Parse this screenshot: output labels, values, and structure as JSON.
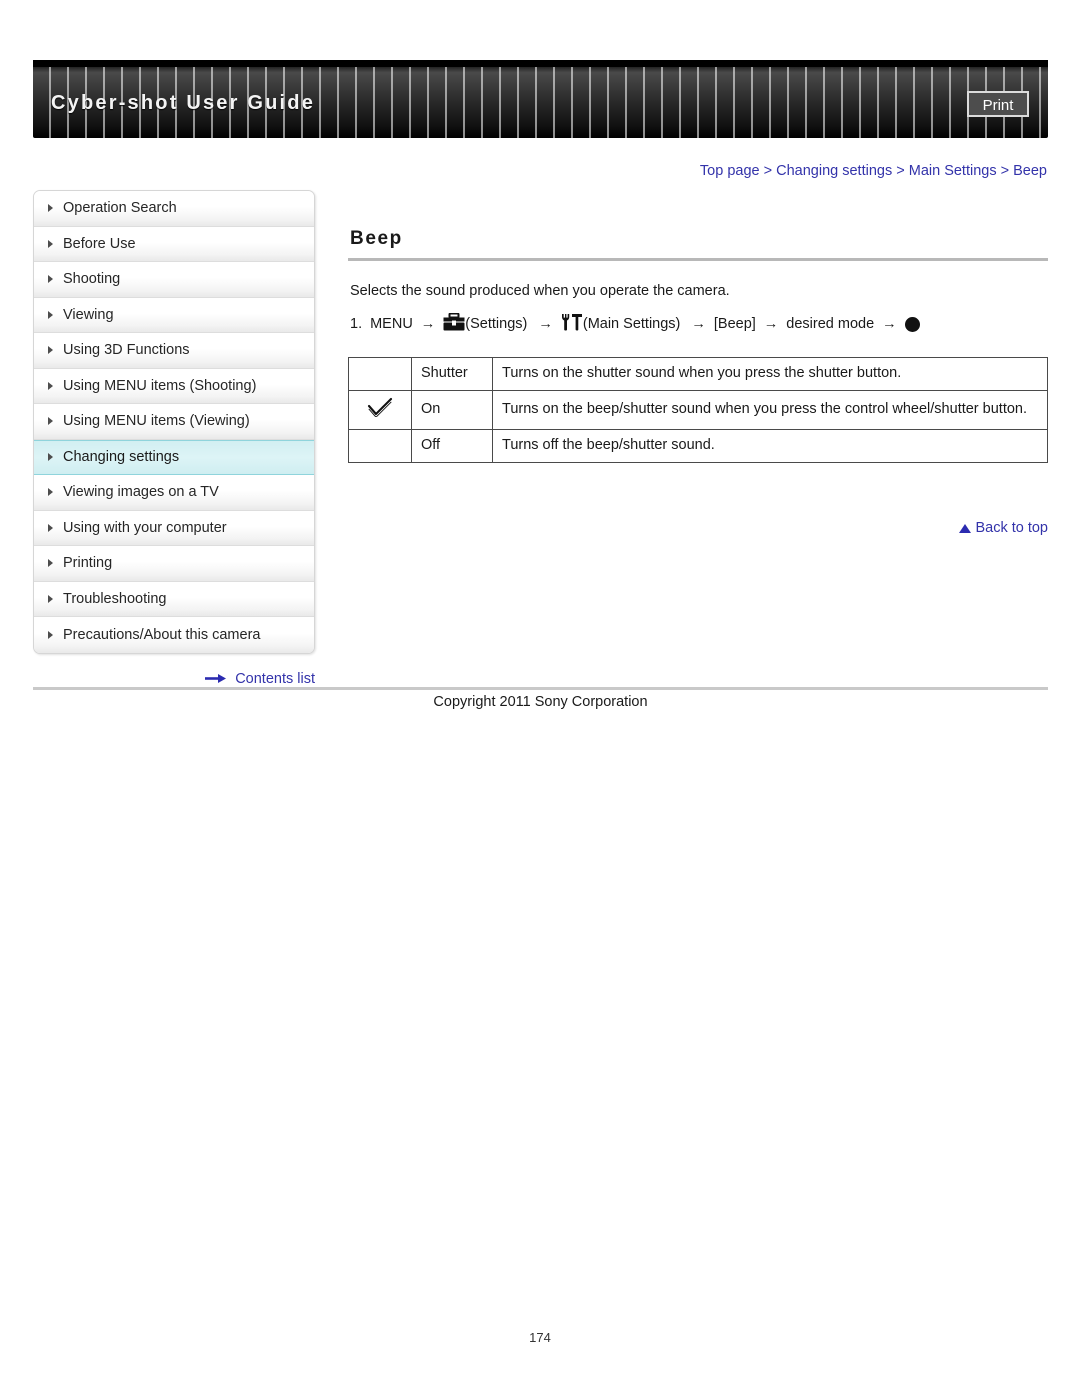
{
  "header": {
    "title": "Cyber-shot User Guide",
    "print_label": "Print"
  },
  "breadcrumb": {
    "items": [
      "Top page",
      "Changing settings",
      "Main Settings",
      "Beep"
    ],
    "separator": ">",
    "full_text": "Top page > Changing settings > Main Settings > Beep"
  },
  "sidebar": {
    "items": [
      {
        "label": "Operation Search",
        "selected": false
      },
      {
        "label": "Before Use",
        "selected": false
      },
      {
        "label": "Shooting",
        "selected": false
      },
      {
        "label": "Viewing",
        "selected": false
      },
      {
        "label": "Using 3D Functions",
        "selected": false
      },
      {
        "label": "Using MENU items (Shooting)",
        "selected": false
      },
      {
        "label": "Using MENU items (Viewing)",
        "selected": false
      },
      {
        "label": "Changing settings",
        "selected": true
      },
      {
        "label": "Viewing images on a TV",
        "selected": false
      },
      {
        "label": "Using with your computer",
        "selected": false
      },
      {
        "label": "Printing",
        "selected": false
      },
      {
        "label": "Troubleshooting",
        "selected": false
      },
      {
        "label": "Precautions/About this camera",
        "selected": false
      }
    ],
    "contents_link": "Contents list",
    "selected_bg": "#d8f2f4"
  },
  "main": {
    "title": "Beep",
    "intro": "Selects the sound produced when you operate the camera.",
    "step": {
      "number": "1.",
      "menu_label": "MENU",
      "settings_label": "(Settings)",
      "main_settings_label": "(Main Settings)",
      "beep_label": "[Beep]",
      "desired_mode_label": "desired mode",
      "arrow": "→"
    },
    "table": {
      "rows": [
        {
          "mark": "",
          "name": "Shutter",
          "desc": "Turns on the shutter sound when you press the shutter button."
        },
        {
          "mark": "check",
          "name": "On",
          "desc": "Turns on the beep/shutter sound when you press the control wheel/shutter button."
        },
        {
          "mark": "",
          "name": "Off",
          "desc": "Turns off the beep/shutter sound."
        }
      ]
    },
    "back_to_top": "Back to top"
  },
  "footer": {
    "copyright": "Copyright 2011 Sony Corporation",
    "page_number": "174"
  },
  "colors": {
    "link": "#3333aa",
    "selected_nav": "#d8f2f4",
    "header_dark": "#1a1a1a"
  }
}
